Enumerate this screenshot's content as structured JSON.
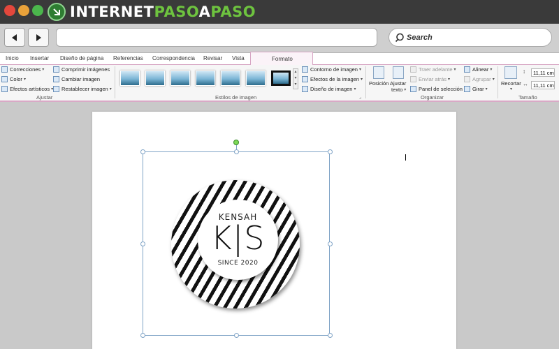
{
  "window": {
    "logo": {
      "part1": "INTERNET",
      "part2": "PASO",
      "part3": "A",
      "part4": "PASO"
    }
  },
  "browser": {
    "address_value": "",
    "search_placeholder": "Search"
  },
  "ribbon": {
    "tabs": [
      "Inicio",
      "Insertar",
      "Diseño de página",
      "Referencias",
      "Correspondencia",
      "Revisar",
      "Vista",
      "Formato"
    ],
    "ajustar": {
      "items": [
        "Correcciones",
        "Color",
        "Efectos artísticos",
        "Comprimir imágenes",
        "Cambiar imagen",
        "Restablecer imagen"
      ],
      "group_label": "Ajustar"
    },
    "estilos": {
      "items": [
        "Contorno de imagen",
        "Efectos de la imagen",
        "Diseño de imagen"
      ],
      "group_label": "Estilos de imagen"
    },
    "organizar": {
      "posicion": "Posición",
      "ajustar_1": "Ajustar",
      "ajustar_2": "texto",
      "traer": "Traer adelante",
      "enviar": "Enviar atrás",
      "panel": "Panel de selección",
      "alinear": "Alinear",
      "agrupar": "Agrupar",
      "girar": "Girar",
      "group_label": "Organizar"
    },
    "tamano": {
      "recortar": "Recortar",
      "height": "11,11 cm",
      "width": "11,11 cm",
      "group_label": "Tamaño"
    }
  },
  "image": {
    "name": "KENSAH",
    "monogram": "K|S",
    "since": "SINCE 2020"
  },
  "colors": {
    "titlebar": "#3a3a3a",
    "accent_green": "#6ec33f",
    "ribbon_accent": "#d9a9c6"
  }
}
